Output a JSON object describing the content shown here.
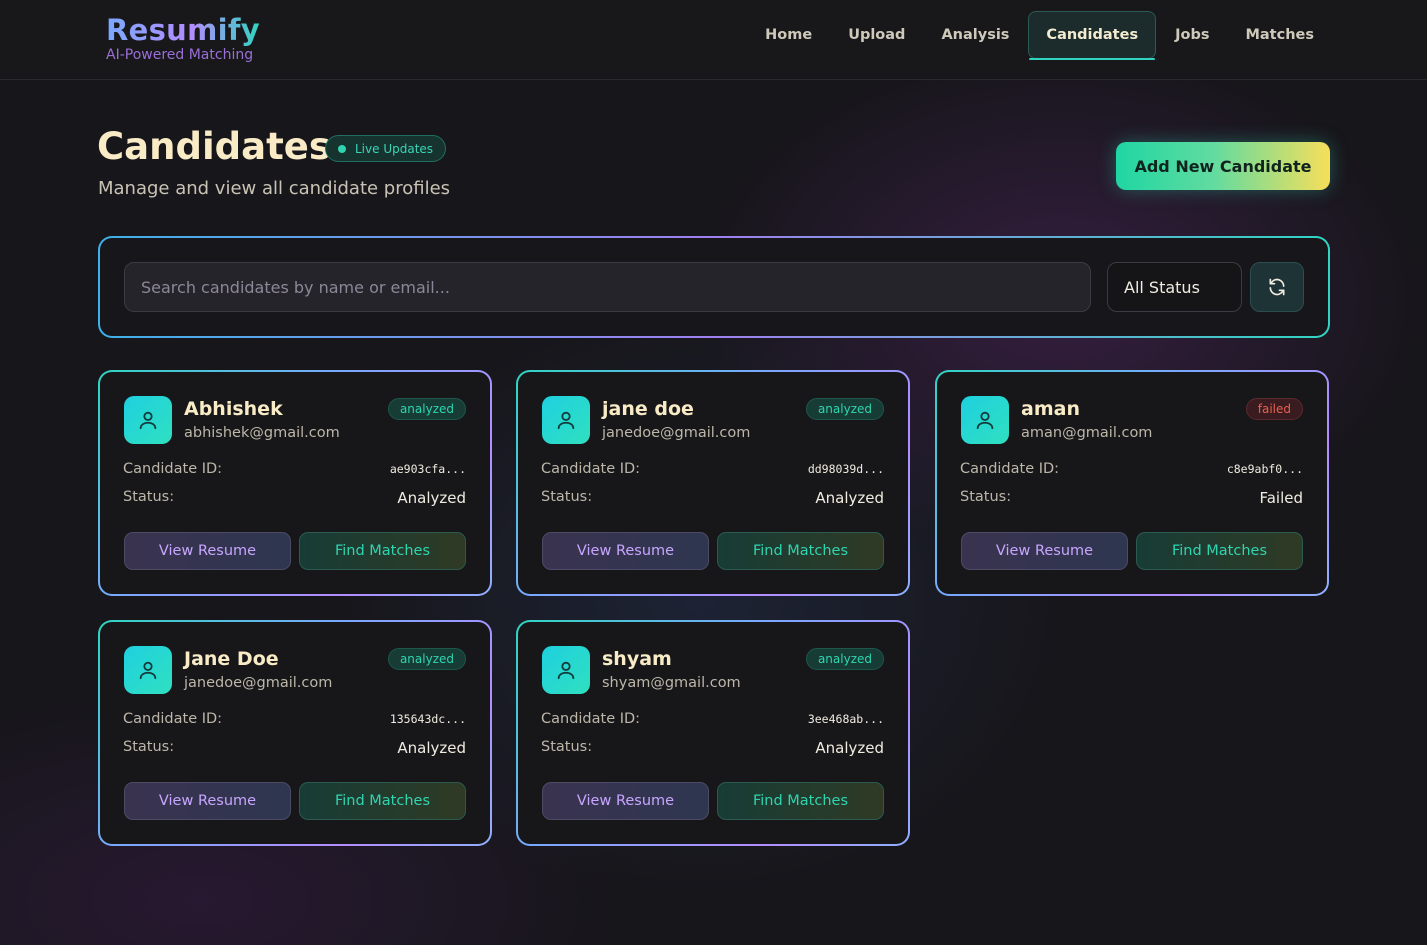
{
  "brand": {
    "name": "Resumify",
    "tagline": "AI-Powered Matching"
  },
  "nav": [
    {
      "label": "Home"
    },
    {
      "label": "Upload"
    },
    {
      "label": "Analysis"
    },
    {
      "label": "Candidates",
      "active": true
    },
    {
      "label": "Jobs"
    },
    {
      "label": "Matches"
    }
  ],
  "page": {
    "title": "Candidates",
    "live_badge": "Live Updates",
    "subtitle": "Manage and view all candidate profiles",
    "add_button": "Add New Candidate"
  },
  "search": {
    "placeholder": "Search candidates by name or email...",
    "value": "",
    "status_filter": "All Status",
    "refresh_icon": "refresh-icon"
  },
  "labels": {
    "candidate_id": "Candidate ID:",
    "status": "Status:",
    "view_resume": "View Resume",
    "find_matches": "Find Matches"
  },
  "candidates": [
    {
      "name": "Abhishek",
      "email": "abhishek@gmail.com",
      "badge": "analyzed",
      "id": "ae903cfa...",
      "status": "Analyzed"
    },
    {
      "name": "jane doe",
      "email": "janedoe@gmail.com",
      "badge": "analyzed",
      "id": "dd98039d...",
      "status": "Analyzed"
    },
    {
      "name": "aman",
      "email": "aman@gmail.com",
      "badge": "failed",
      "id": "c8e9abf0...",
      "status": "Failed"
    },
    {
      "name": "Jane Doe",
      "email": "janedoe@gmail.com",
      "badge": "analyzed",
      "id": "135643dc...",
      "status": "Analyzed"
    },
    {
      "name": "shyam",
      "email": "shyam@gmail.com",
      "badge": "analyzed",
      "id": "3ee468ab...",
      "status": "Analyzed"
    }
  ],
  "colors": {
    "accent_teal": "#2fd5c0",
    "accent_purple": "#b48cff",
    "title_cream": "#f8ebc6",
    "failed_red": "#ea5f50"
  }
}
